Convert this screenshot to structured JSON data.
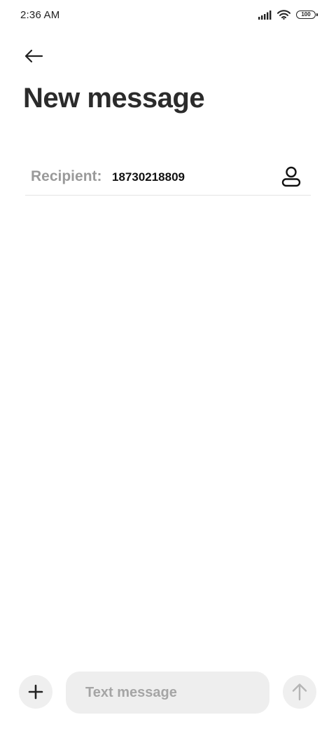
{
  "status_bar": {
    "time": "2:36 AM",
    "battery_level": "100",
    "icons": [
      "signal-icon",
      "wifi-icon",
      "battery-icon"
    ]
  },
  "header": {
    "back_icon": "arrow-left-icon",
    "title": "New message"
  },
  "recipient": {
    "label": "Recipient:",
    "value": "18730218809",
    "contact_icon": "person-icon"
  },
  "composer": {
    "attach_icon": "plus-icon",
    "placeholder": "Text message",
    "send_icon": "arrow-up-icon"
  },
  "colors": {
    "background": "#ffffff",
    "title": "#2b2b2b",
    "label_gray": "#9a9a9a",
    "input_bg": "#eeeeee",
    "button_bg": "#efefef",
    "divider": "#e3e3e3",
    "send_icon_disabled": "#b5b5b5"
  }
}
